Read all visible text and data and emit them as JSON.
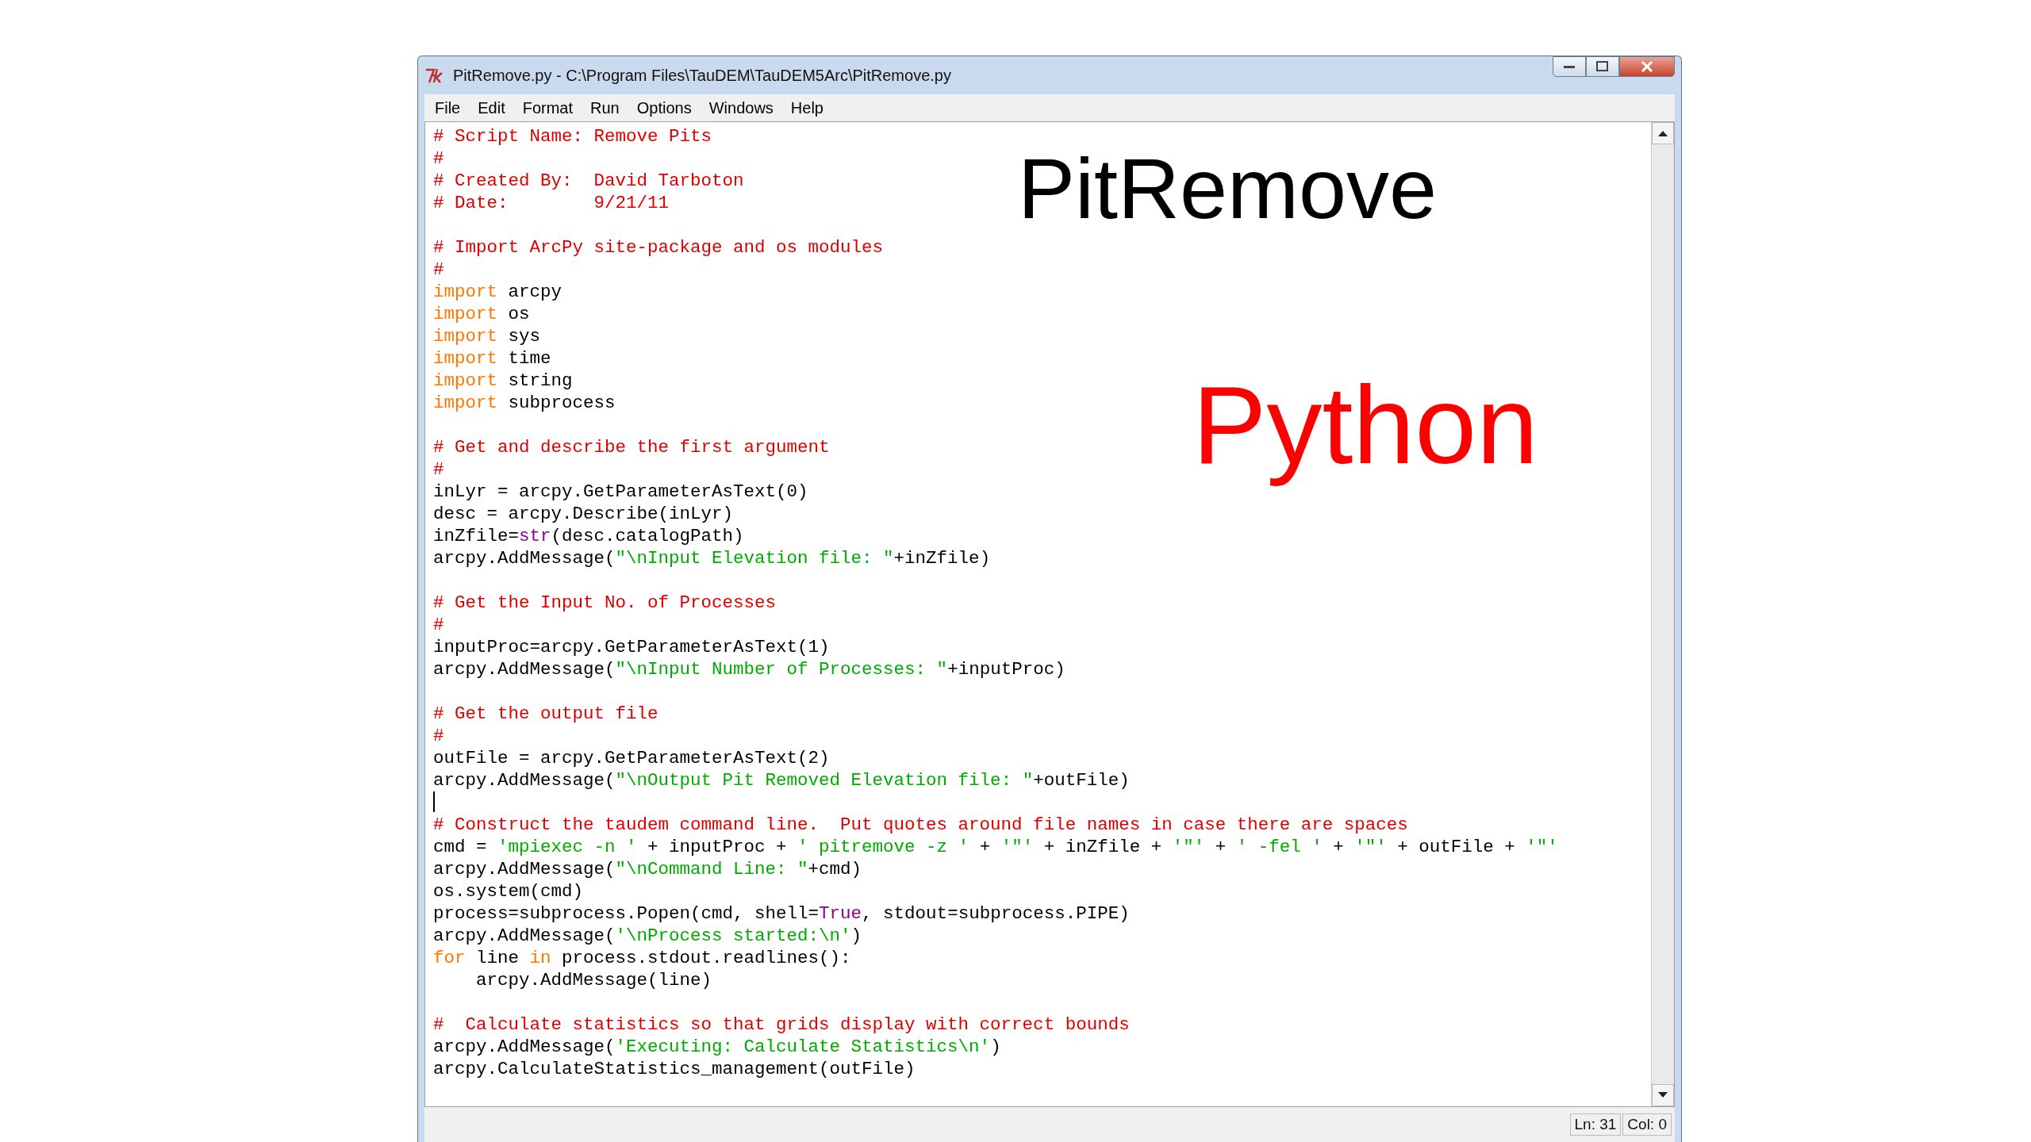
{
  "window": {
    "title": "PitRemove.py - C:\\Program Files\\TauDEM\\TauDEM5Arc\\PitRemove.py"
  },
  "menu": [
    "File",
    "Edit",
    "Format",
    "Run",
    "Options",
    "Windows",
    "Help"
  ],
  "editor": {
    "lines": [
      {
        "kind": "code",
        "segments": [
          {
            "kind": "comment",
            "text": "# Script Name: Remove Pits"
          }
        ]
      },
      {
        "kind": "code",
        "segments": [
          {
            "kind": "comment",
            "text": "#"
          }
        ]
      },
      {
        "kind": "code",
        "segments": [
          {
            "kind": "comment",
            "text": "# Created By:  David Tarboton"
          }
        ]
      },
      {
        "kind": "code",
        "segments": [
          {
            "kind": "comment",
            "text": "# Date:        9/21/11"
          }
        ]
      },
      {
        "kind": "blank",
        "cursor": false
      },
      {
        "kind": "code",
        "segments": [
          {
            "kind": "comment",
            "text": "# Import ArcPy site-package and os modules"
          }
        ]
      },
      {
        "kind": "code",
        "segments": [
          {
            "kind": "comment",
            "text": "#"
          }
        ]
      },
      {
        "kind": "code",
        "segments": [
          {
            "kind": "keyword",
            "text": "import"
          },
          {
            "kind": "plain",
            "text": " arcpy"
          }
        ]
      },
      {
        "kind": "code",
        "segments": [
          {
            "kind": "keyword",
            "text": "import"
          },
          {
            "kind": "plain",
            "text": " os"
          }
        ]
      },
      {
        "kind": "code",
        "segments": [
          {
            "kind": "keyword",
            "text": "import"
          },
          {
            "kind": "plain",
            "text": " sys"
          }
        ]
      },
      {
        "kind": "code",
        "segments": [
          {
            "kind": "keyword",
            "text": "import"
          },
          {
            "kind": "plain",
            "text": " time"
          }
        ]
      },
      {
        "kind": "code",
        "segments": [
          {
            "kind": "keyword",
            "text": "import"
          },
          {
            "kind": "plain",
            "text": " string"
          }
        ]
      },
      {
        "kind": "code",
        "segments": [
          {
            "kind": "keyword",
            "text": "import"
          },
          {
            "kind": "plain",
            "text": " subprocess"
          }
        ]
      },
      {
        "kind": "blank",
        "cursor": false
      },
      {
        "kind": "code",
        "segments": [
          {
            "kind": "comment",
            "text": "# Get and describe the first argument"
          }
        ]
      },
      {
        "kind": "code",
        "segments": [
          {
            "kind": "comment",
            "text": "#"
          }
        ]
      },
      {
        "kind": "code",
        "segments": [
          {
            "kind": "plain",
            "text": "inLyr = arcpy.GetParameterAsText(0)"
          }
        ]
      },
      {
        "kind": "code",
        "segments": [
          {
            "kind": "plain",
            "text": "desc = arcpy.Describe(inLyr)"
          }
        ]
      },
      {
        "kind": "code",
        "segments": [
          {
            "kind": "plain",
            "text": "inZfile="
          },
          {
            "kind": "builtin",
            "text": "str"
          },
          {
            "kind": "plain",
            "text": "(desc.catalogPath)"
          }
        ]
      },
      {
        "kind": "code",
        "segments": [
          {
            "kind": "plain",
            "text": "arcpy.AddMessage("
          },
          {
            "kind": "string",
            "text": "\"\\nInput Elevation file: \""
          },
          {
            "kind": "plain",
            "text": "+inZfile)"
          }
        ]
      },
      {
        "kind": "blank",
        "cursor": false
      },
      {
        "kind": "code",
        "segments": [
          {
            "kind": "comment",
            "text": "# Get the Input No. of Processes"
          }
        ]
      },
      {
        "kind": "code",
        "segments": [
          {
            "kind": "comment",
            "text": "#"
          }
        ]
      },
      {
        "kind": "code",
        "segments": [
          {
            "kind": "plain",
            "text": "inputProc=arcpy.GetParameterAsText(1)"
          }
        ]
      },
      {
        "kind": "code",
        "segments": [
          {
            "kind": "plain",
            "text": "arcpy.AddMessage("
          },
          {
            "kind": "string",
            "text": "\"\\nInput Number of Processes: \""
          },
          {
            "kind": "plain",
            "text": "+inputProc)"
          }
        ]
      },
      {
        "kind": "blank",
        "cursor": false
      },
      {
        "kind": "code",
        "segments": [
          {
            "kind": "comment",
            "text": "# Get the output file"
          }
        ]
      },
      {
        "kind": "code",
        "segments": [
          {
            "kind": "comment",
            "text": "#"
          }
        ]
      },
      {
        "kind": "code",
        "segments": [
          {
            "kind": "plain",
            "text": "outFile = arcpy.GetParameterAsText(2)"
          }
        ]
      },
      {
        "kind": "code",
        "segments": [
          {
            "kind": "plain",
            "text": "arcpy.AddMessage("
          },
          {
            "kind": "string",
            "text": "\"\\nOutput Pit Removed Elevation file: \""
          },
          {
            "kind": "plain",
            "text": "+outFile)"
          }
        ]
      },
      {
        "kind": "blank",
        "cursor": true
      },
      {
        "kind": "code",
        "segments": [
          {
            "kind": "comment",
            "text": "# Construct the taudem command line.  Put quotes around file names in case there are spaces"
          }
        ]
      },
      {
        "kind": "code",
        "segments": [
          {
            "kind": "plain",
            "text": "cmd = "
          },
          {
            "kind": "string",
            "text": "'mpiexec -n '"
          },
          {
            "kind": "plain",
            "text": " + inputProc + "
          },
          {
            "kind": "string",
            "text": "' pitremove -z '"
          },
          {
            "kind": "plain",
            "text": " + "
          },
          {
            "kind": "string",
            "text": "'\"'"
          },
          {
            "kind": "plain",
            "text": " + inZfile + "
          },
          {
            "kind": "string",
            "text": "'\"'"
          },
          {
            "kind": "plain",
            "text": " + "
          },
          {
            "kind": "string",
            "text": "' -fel '"
          },
          {
            "kind": "plain",
            "text": " + "
          },
          {
            "kind": "string",
            "text": "'\"'"
          },
          {
            "kind": "plain",
            "text": " + outFile + "
          },
          {
            "kind": "string",
            "text": "'\"'"
          }
        ]
      },
      {
        "kind": "code",
        "segments": [
          {
            "kind": "plain",
            "text": "arcpy.AddMessage("
          },
          {
            "kind": "string",
            "text": "\"\\nCommand Line: \""
          },
          {
            "kind": "plain",
            "text": "+cmd)"
          }
        ]
      },
      {
        "kind": "code",
        "segments": [
          {
            "kind": "plain",
            "text": "os.system(cmd)"
          }
        ]
      },
      {
        "kind": "code",
        "segments": [
          {
            "kind": "plain",
            "text": "process=subprocess.Popen(cmd, shell="
          },
          {
            "kind": "builtin",
            "text": "True"
          },
          {
            "kind": "plain",
            "text": ", stdout=subprocess.PIPE)"
          }
        ]
      },
      {
        "kind": "code",
        "segments": [
          {
            "kind": "plain",
            "text": "arcpy.AddMessage("
          },
          {
            "kind": "string",
            "text": "'\\nProcess started:\\n'"
          },
          {
            "kind": "plain",
            "text": ")"
          }
        ]
      },
      {
        "kind": "code",
        "segments": [
          {
            "kind": "keyword",
            "text": "for"
          },
          {
            "kind": "plain",
            "text": " line "
          },
          {
            "kind": "keyword",
            "text": "in"
          },
          {
            "kind": "plain",
            "text": " process.stdout.readlines():"
          }
        ]
      },
      {
        "kind": "code",
        "segments": [
          {
            "kind": "plain",
            "text": "    arcpy.AddMessage(line)"
          }
        ]
      },
      {
        "kind": "blank",
        "cursor": false
      },
      {
        "kind": "code",
        "segments": [
          {
            "kind": "comment",
            "text": "#  Calculate statistics so that grids display with correct bounds"
          }
        ]
      },
      {
        "kind": "code",
        "segments": [
          {
            "kind": "plain",
            "text": "arcpy.AddMessage("
          },
          {
            "kind": "string",
            "text": "'Executing: Calculate Statistics\\n'"
          },
          {
            "kind": "plain",
            "text": ")"
          }
        ]
      },
      {
        "kind": "code",
        "segments": [
          {
            "kind": "plain",
            "text": "arcpy.CalculateStatistics_management(outFile)"
          }
        ]
      }
    ]
  },
  "overlay": {
    "heading": "PitRemove",
    "language": "Python"
  },
  "status_bar": {
    "line": "Ln: 31",
    "column": "Col: 0"
  }
}
